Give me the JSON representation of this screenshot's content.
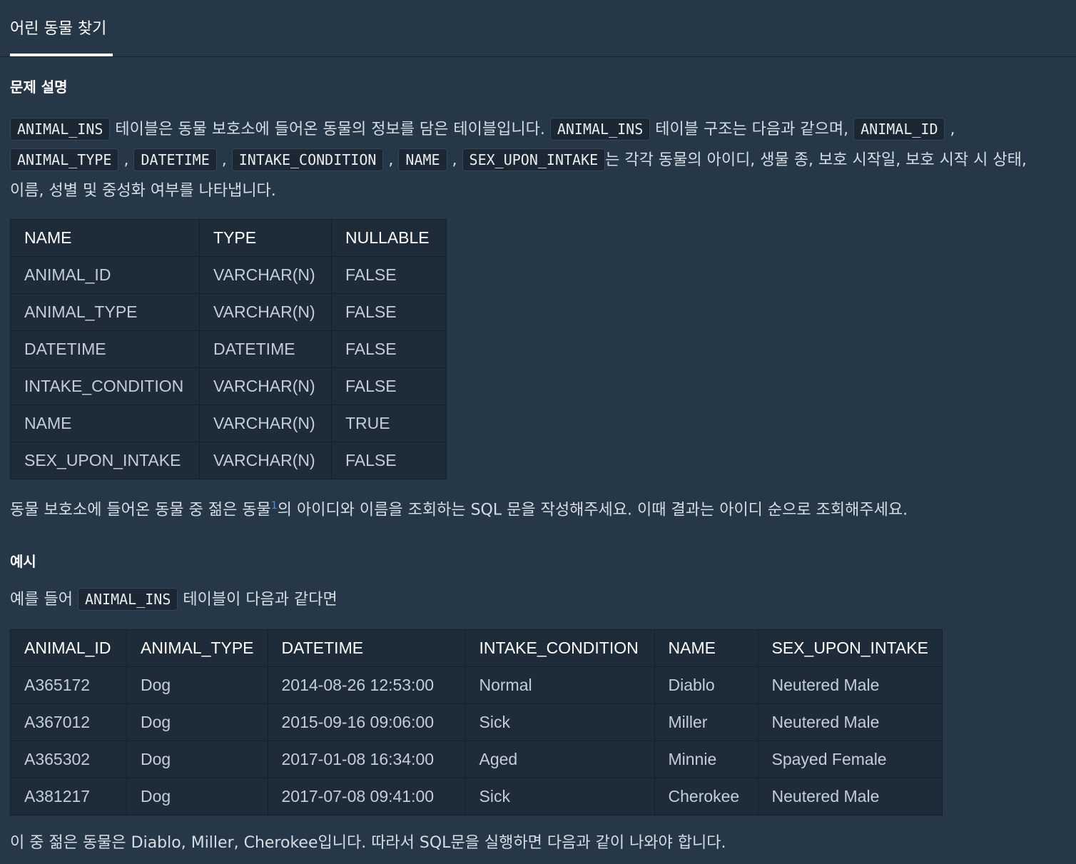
{
  "tab": {
    "label": "어린 동물 찾기"
  },
  "section_desc": "문제 설명",
  "desc": {
    "code1": "ANIMAL_INS",
    "text1": " 테이블은 동물 보호소에 들어온 동물의 정보를 담은 테이블입니다. ",
    "code2": "ANIMAL_INS",
    "text2": " 테이블 구조는 다음과 같으며, ",
    "code3": "ANIMAL_ID",
    "sep1": " ,",
    "code4": "ANIMAL_TYPE",
    "sep2": " , ",
    "code5": "DATETIME",
    "sep3": " , ",
    "code6": "INTAKE_CONDITION",
    "sep4": " , ",
    "code7": "NAME",
    "sep5": " , ",
    "code8": "SEX_UPON_INTAKE",
    "text3": "는 각각 동물의 아이디, 생물 종, 보호 시작일, 보호 시작 시 상태,",
    "text4": "이름, 성별 및 중성화 여부를 나타냅니다."
  },
  "schema_table": {
    "headers": [
      "NAME",
      "TYPE",
      "NULLABLE"
    ],
    "rows": [
      [
        "ANIMAL_ID",
        "VARCHAR(N)",
        "FALSE"
      ],
      [
        "ANIMAL_TYPE",
        "VARCHAR(N)",
        "FALSE"
      ],
      [
        "DATETIME",
        "DATETIME",
        "FALSE"
      ],
      [
        "INTAKE_CONDITION",
        "VARCHAR(N)",
        "FALSE"
      ],
      [
        "NAME",
        "VARCHAR(N)",
        "TRUE"
      ],
      [
        "SEX_UPON_INTAKE",
        "VARCHAR(N)",
        "FALSE"
      ]
    ]
  },
  "question": {
    "text1": "동물 보호소에 들어온 동물 중 젊은 동물",
    "footnote": "1",
    "text2": "의 아이디와 이름을 조회하는 SQL 문을 작성해주세요. 이때 결과는 아이디 순으로 조회해주세요."
  },
  "section_example": "예시",
  "example_intro": {
    "text1": "예를 들어 ",
    "code": "ANIMAL_INS",
    "text2": " 테이블이 다음과 같다면"
  },
  "example_table": {
    "headers": [
      "ANIMAL_ID",
      "ANIMAL_TYPE",
      "DATETIME",
      "INTAKE_CONDITION",
      "NAME",
      "SEX_UPON_INTAKE"
    ],
    "rows": [
      [
        "A365172",
        "Dog",
        "2014-08-26 12:53:00",
        "Normal",
        "Diablo",
        "Neutered Male"
      ],
      [
        "A367012",
        "Dog",
        "2015-09-16 09:06:00",
        "Sick",
        "Miller",
        "Neutered Male"
      ],
      [
        "A365302",
        "Dog",
        "2017-01-08 16:34:00",
        "Aged",
        "Minnie",
        "Spayed Female"
      ],
      [
        "A381217",
        "Dog",
        "2017-07-08 09:41:00",
        "Sick",
        "Cherokee",
        "Neutered Male"
      ]
    ]
  },
  "conclusion": "이 중 젊은 동물은 Diablo, Miller, Cherokee입니다. 따라서 SQL문을 실행하면 다음과 같이 나와야 합니다."
}
